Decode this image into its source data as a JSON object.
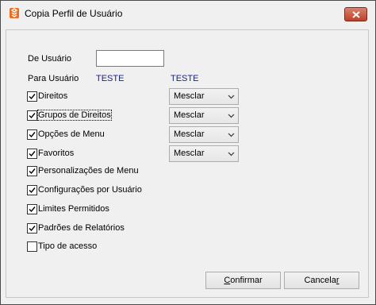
{
  "window": {
    "title": "Copia Perfil de Usuário",
    "icon": "app-logo-icon",
    "accent_color": "#f26b1d"
  },
  "form": {
    "de_usuario_label": "De Usuário",
    "de_usuario_value": "",
    "para_usuario_label": "Para Usuário",
    "para_usuario_value": "TESTE",
    "para_usuario_value_2": "TESTE"
  },
  "options": [
    {
      "label": "Direitos",
      "checked": true,
      "select": "Mesclar"
    },
    {
      "label": "Grupos de Direitos",
      "checked": true,
      "select": "Mesclar",
      "focused": true
    },
    {
      "label": "Opções de Menu",
      "checked": true,
      "select": "Mesclar"
    },
    {
      "label": "Favoritos",
      "checked": true,
      "select": "Mesclar"
    },
    {
      "label": "Personalizações de Menu",
      "checked": true
    },
    {
      "label": "Configurações por Usuário",
      "checked": true
    },
    {
      "label": "Limites Permitidos",
      "checked": true
    },
    {
      "label": "Padrões de Relatórios",
      "checked": true
    },
    {
      "label": "Tipo de acesso",
      "checked": false
    }
  ],
  "buttons": {
    "confirm_label_underlined": "C",
    "confirm_label_rest": "onfirmar",
    "cancel_label_rest": "Cancela",
    "cancel_label_underlined": "r"
  }
}
